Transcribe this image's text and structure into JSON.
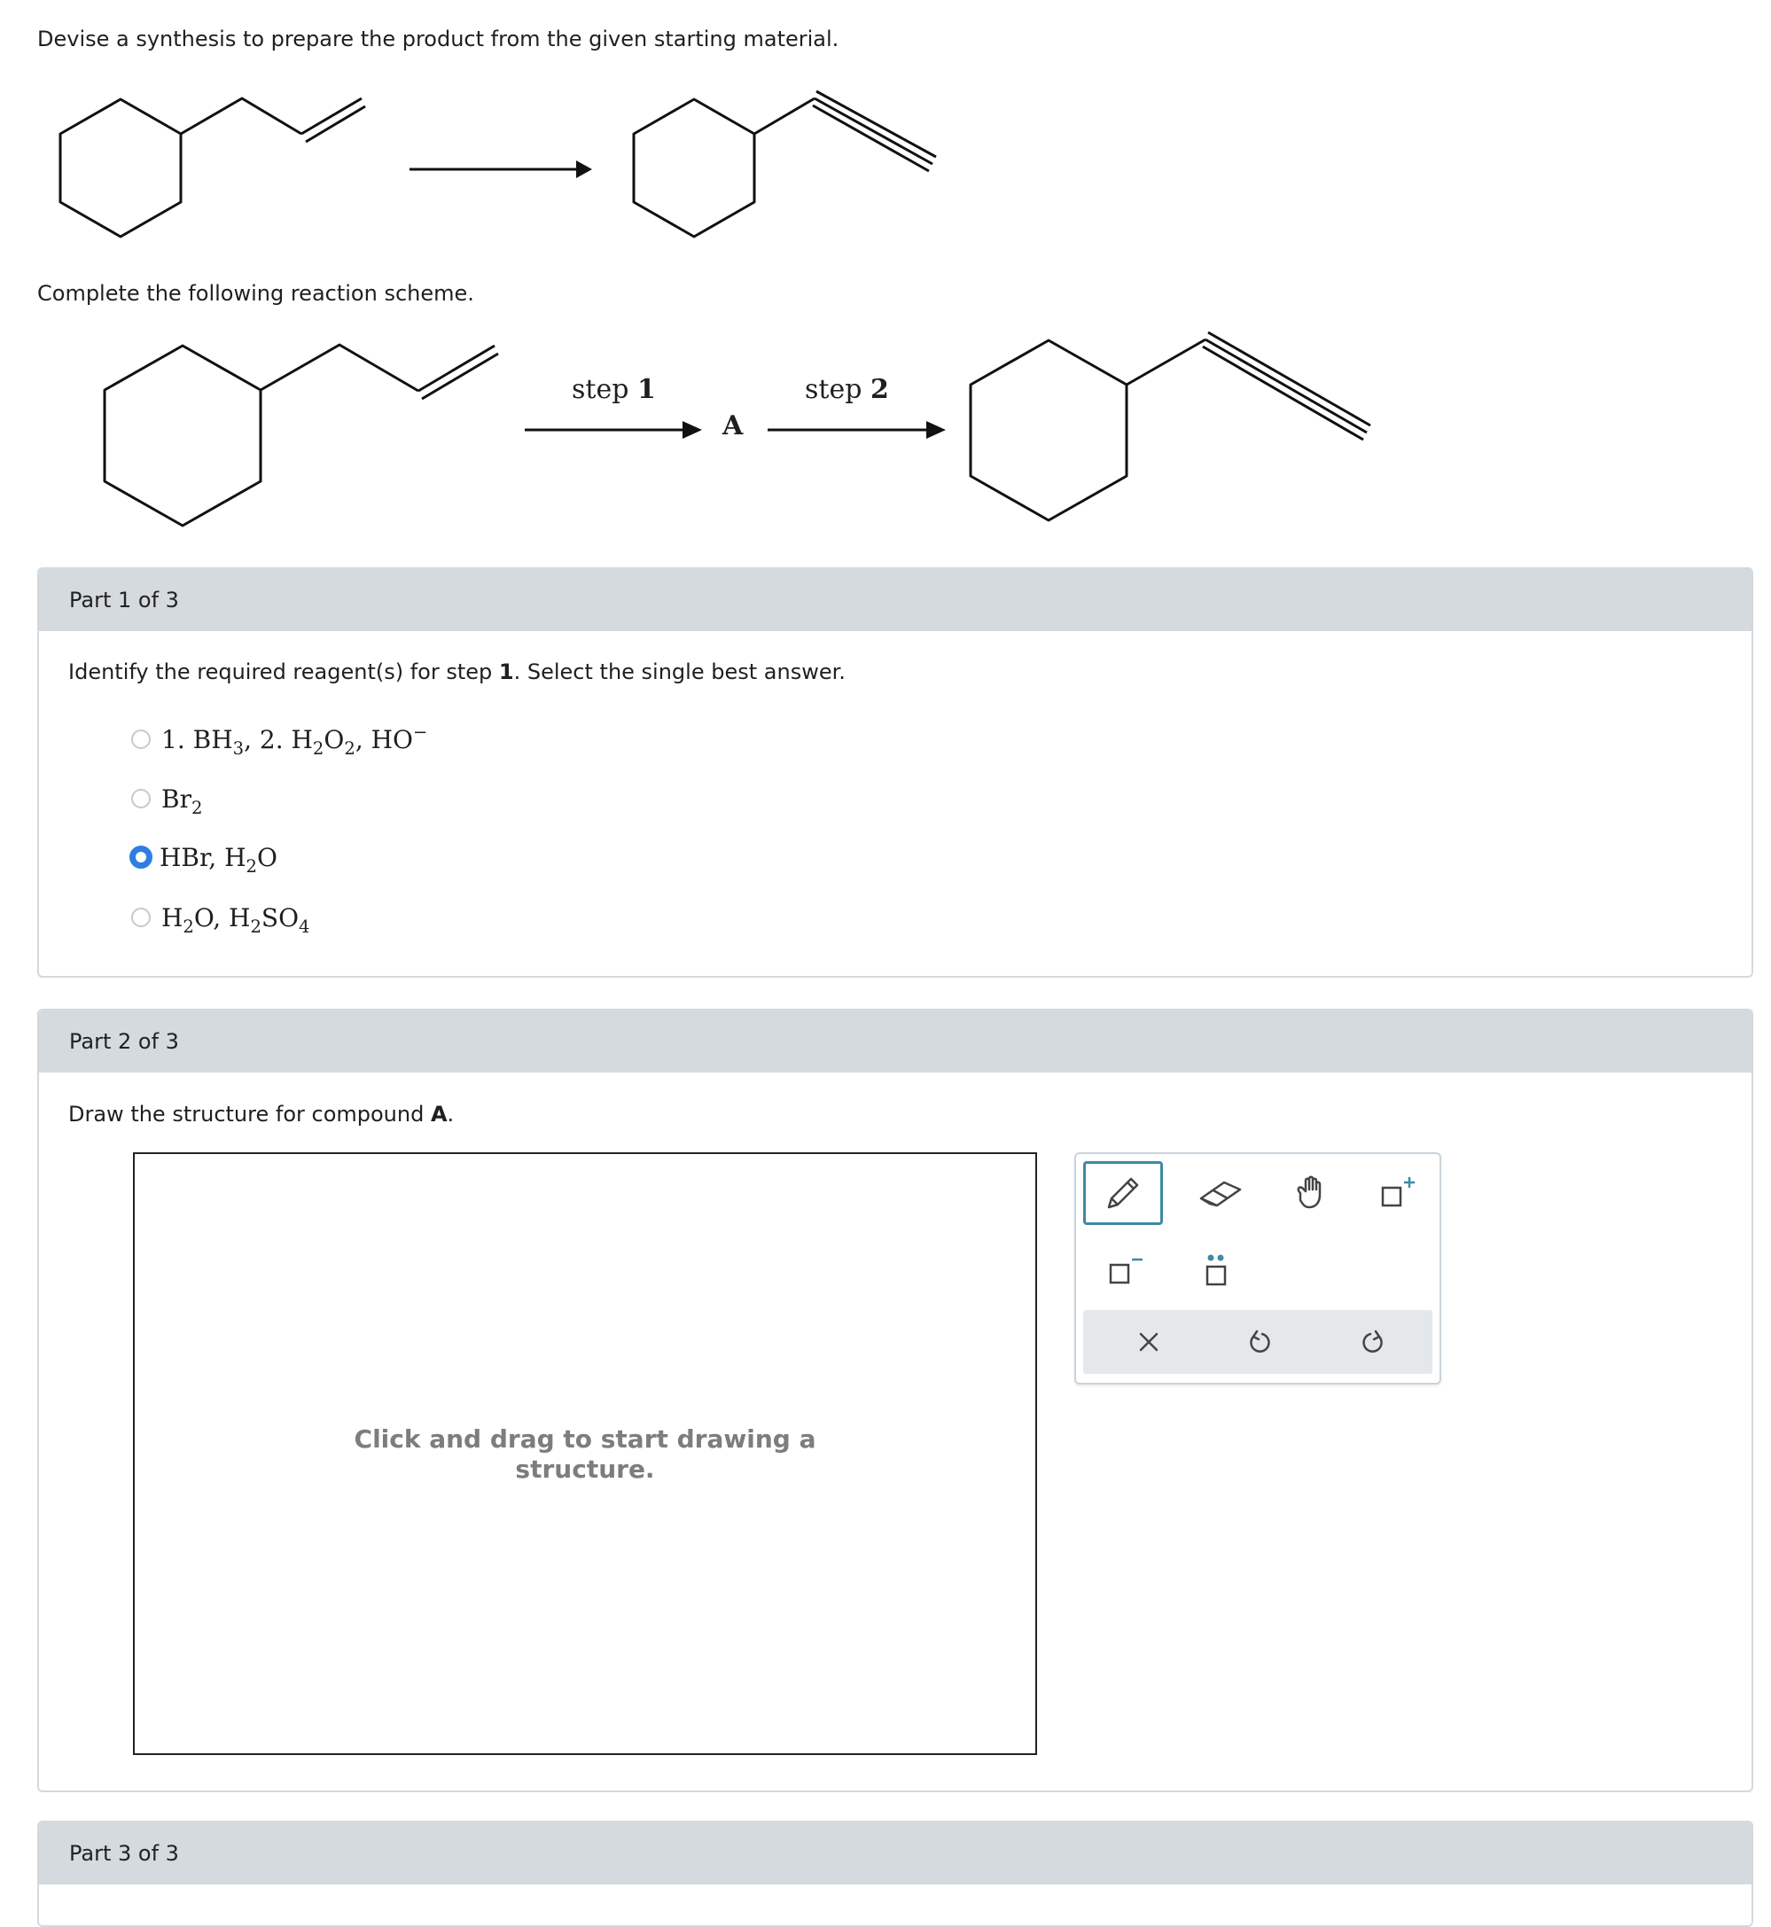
{
  "question": {
    "intro": "Devise a synthesis to prepare the product from the given starting material.",
    "scheme_prompt": "Complete the following reaction scheme."
  },
  "scheme": {
    "step1_word": "step",
    "step1_num": "1",
    "step2_word": "step",
    "step2_num": "2",
    "intermediate": "A"
  },
  "part1": {
    "header": "Part 1 of 3",
    "prompt_before": "Identify the required reagent(s) for step ",
    "prompt_bold": "1",
    "prompt_after": ". Select the single best answer.",
    "options": [
      {
        "text": "1. BH3, 2. H2O2, HO−",
        "selected": false
      },
      {
        "text": "Br2",
        "selected": false
      },
      {
        "text": "HBr, H2O",
        "selected": true
      },
      {
        "text": "H2O, H2SO4",
        "selected": false
      }
    ]
  },
  "part2": {
    "header": "Part 2 of 3",
    "prompt_before": "Draw the structure for compound ",
    "prompt_bold": "A",
    "prompt_after": ".",
    "canvas_hint_line1": "Click and drag to start drawing a",
    "canvas_hint_line2": "structure."
  },
  "part3": {
    "header": "Part 3 of 3"
  },
  "toolbar": {
    "tools": [
      "pencil-icon",
      "eraser-icon",
      "hand-icon",
      "add-charge-icon",
      "negative-charge-icon",
      "lone-pair-icon",
      "clear-icon",
      "undo-icon",
      "redo-icon"
    ],
    "accent": "#3d8aa3"
  },
  "colors": {
    "radio_selected": "#2f7de1",
    "part_header_bg": "#d4dade",
    "hint_text": "#7d7d7d"
  }
}
